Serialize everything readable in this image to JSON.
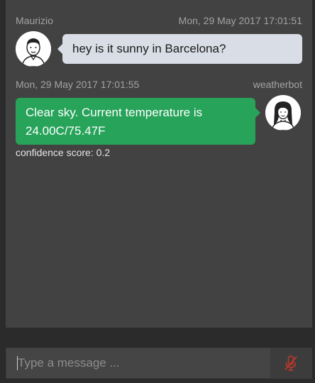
{
  "conversation": {
    "messages": [
      {
        "sender": "Maurizio",
        "timestamp": "Mon, 29 May 2017 17:01:51",
        "text": "hey is it sunny in Barcelona?",
        "avatar": "man-avatar-icon"
      },
      {
        "sender": "weatherbot",
        "timestamp": "Mon, 29 May 2017 17:01:55",
        "text_line1": "Clear sky. Current temperature is",
        "text_line2": "24.00C/75.47F",
        "confidence": "confidence score: 0.2",
        "avatar": "woman-avatar-icon"
      }
    ]
  },
  "composer": {
    "placeholder": "Type a message ...",
    "mic_icon": "mic-off-icon"
  },
  "colors": {
    "user_bubble": "#d9dde6",
    "bot_bubble": "#27a35a",
    "panel": "#424242",
    "background": "#2b2b2b"
  }
}
